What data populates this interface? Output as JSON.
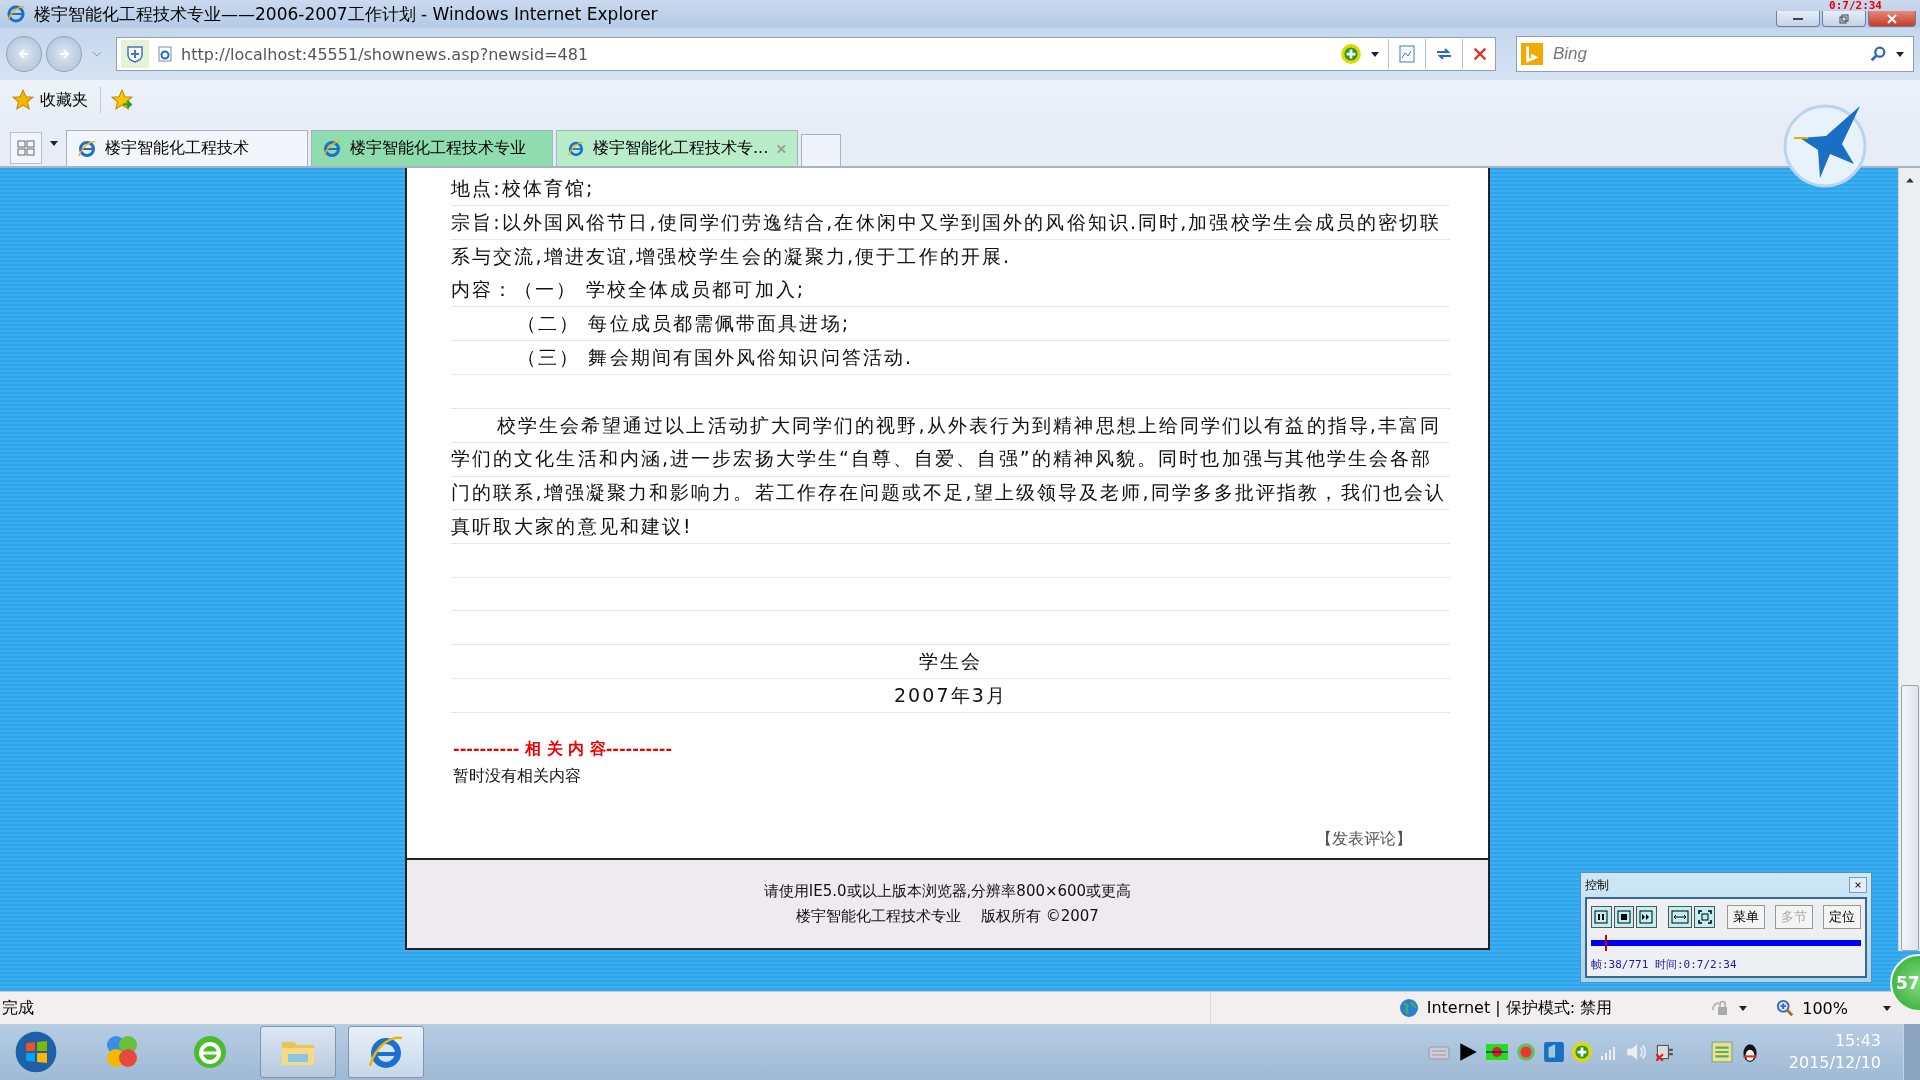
{
  "window": {
    "title": "楼宇智能化工程技术专业——2006-2007工作计划 - Windows Internet Explorer",
    "overlay_timer": "0:7/2:34"
  },
  "address_bar": {
    "url": "http://localhost:45551/shownews.asp?newsid=481"
  },
  "search": {
    "placeholder": "Bing"
  },
  "favorites_bar": {
    "label": "收藏夹"
  },
  "tabs": [
    {
      "label": "楼宇智能化工程技术",
      "selected": false,
      "grouped": false
    },
    {
      "label": "楼宇智能化工程技术专业",
      "selected": false,
      "grouped": true
    },
    {
      "label": "楼宇智能化工程技术专...",
      "selected": true,
      "grouped": true
    }
  ],
  "article": [
    {
      "kind": "row",
      "text": "地点:校体育馆;"
    },
    {
      "kind": "paragraph",
      "text": "宗旨:以外国风俗节日,使同学们劳逸结合,在休闲中又学到国外的风俗知识.同时,加强校学生会成员的密切联系与交流,增进友谊,增强校学生会的凝聚力,便于工作的开展."
    },
    {
      "kind": "row",
      "text": "内容：（一） 学校全体成员都可加入;"
    },
    {
      "kind": "indent",
      "text": "（二） 每位成员都需佩带面具进场;"
    },
    {
      "kind": "indent",
      "text": "（三） 舞会期间有国外风俗知识问答活动."
    },
    {
      "kind": "blank"
    },
    {
      "kind": "indented_paragraph",
      "text": "校学生会希望通过以上活动扩大同学们的视野,从外表行为到精神思想上给同学们以有益的指导,丰富同学们的文化生活和内涵,进一步宏扬大学生“自尊、自爱、自强”的精神风貌。同时也加强与其他学生会各部门的联系,增强凝聚力和影响力。若工作存在问题或不足,望上级领导及老师,同学多多批评指教，我们也会认真听取大家的意见和建议!"
    },
    {
      "kind": "blank"
    },
    {
      "kind": "blank"
    },
    {
      "kind": "blank"
    },
    {
      "kind": "center",
      "text": "学生会"
    },
    {
      "kind": "center",
      "text": "2007年3月"
    }
  ],
  "related": {
    "heading": "---------- 相 关 内 容----------",
    "empty_text": "暂时没有相关内容"
  },
  "comment_link": "【发表评论】",
  "footer": {
    "lines": [
      "请使用IE5.0或以上版本浏览器,分辨率800×600或更高",
      "楼宇智能化工程技术专业　 版权所有 ©2007"
    ]
  },
  "player_control": {
    "title": "控制",
    "buttons": [
      {
        "label": "菜单",
        "disabled": false
      },
      {
        "label": "多节",
        "disabled": true
      },
      {
        "label": "定位",
        "disabled": false
      }
    ],
    "level": 0.05,
    "info": "帧:38/771 时间:0:7/2:34"
  },
  "badge": "57",
  "status_bar": {
    "text": "完成",
    "zone": "Internet | 保护模式: 禁用",
    "zoom": "100%"
  },
  "taskbar": {
    "time": "15:43",
    "date": "2015/12/10"
  }
}
